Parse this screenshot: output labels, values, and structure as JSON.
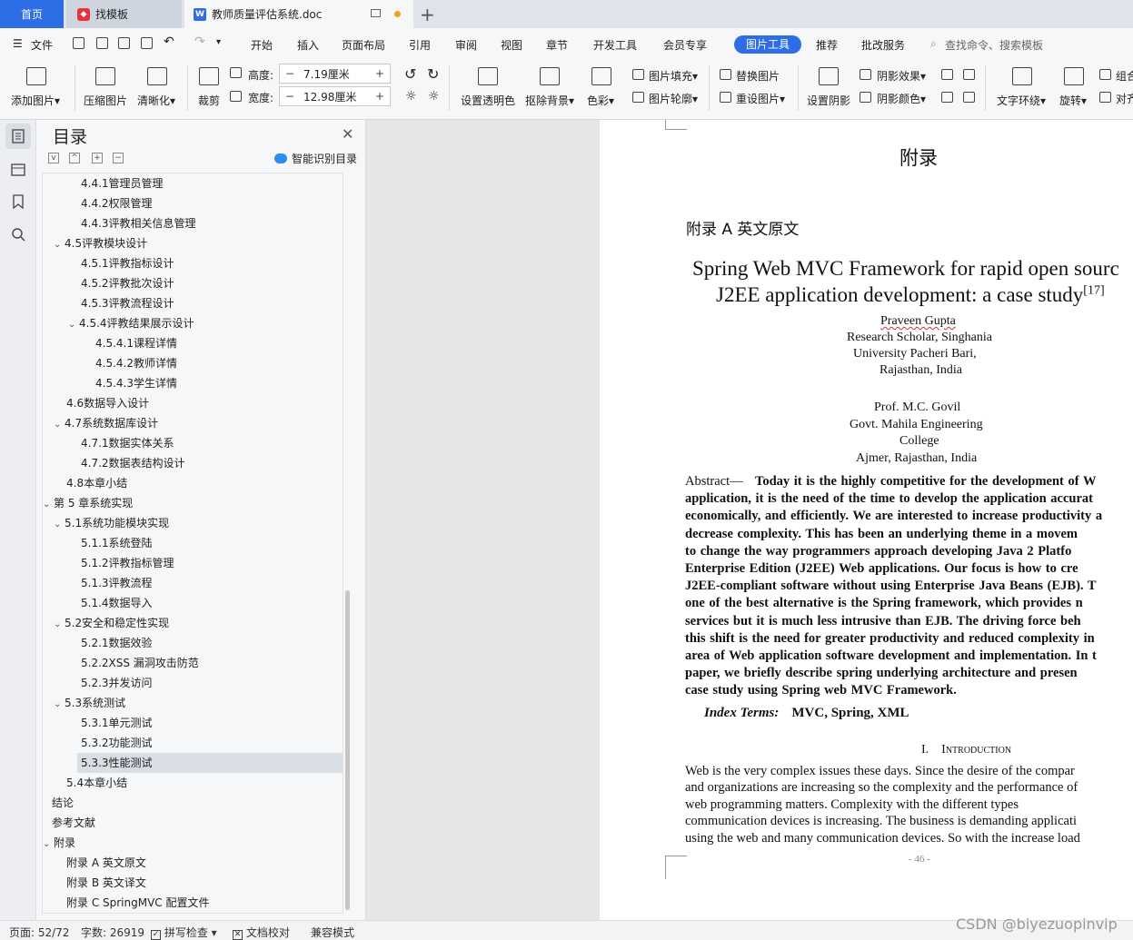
{
  "tabs": {
    "home": "首页",
    "find_template": "找模板",
    "doc": "教师质量评估系统.doc"
  },
  "menu": {
    "file": "文件",
    "items": [
      "开始",
      "插入",
      "页面布局",
      "引用",
      "审阅",
      "视图",
      "章节",
      "开发工具",
      "会员专享"
    ],
    "active": "图片工具",
    "items_after": [
      "推荐",
      "批改服务"
    ],
    "search": "查找命令、搜索模板"
  },
  "ribbon": {
    "add_image": "添加图片",
    "compress": "压缩图片",
    "clarity": "清晰化",
    "crop": "裁剪",
    "height_label": "高度:",
    "height_value": "7.19厘米",
    "width_label": "宽度:",
    "width_value": "12.98厘米",
    "transparent": "设置透明色",
    "remove_bg": "抠除背景",
    "color": "色彩",
    "image_fill": "图片填充",
    "image_outline": "图片轮廓",
    "replace_image": "替换图片",
    "reset_image": "重设图片",
    "set_shadow": "设置阴影",
    "shadow_effect": "阴影效果",
    "shadow_color": "阴影颜色",
    "text_wrap": "文字环绕",
    "rotate": "旋转",
    "group": "组合",
    "align": "对齐"
  },
  "toc": {
    "title": "目录",
    "smart": "智能识别目录",
    "items": [
      {
        "text": "4.4.1管理员管理",
        "level": 3,
        "caret": ""
      },
      {
        "text": "4.4.2权限管理",
        "level": 3,
        "caret": ""
      },
      {
        "text": "4.4.3评教相关信息管理",
        "level": 3,
        "caret": ""
      },
      {
        "text": "4.5评教模块设计",
        "level": 2,
        "caret": "v"
      },
      {
        "text": "4.5.1评教指标设计",
        "level": 3,
        "caret": ""
      },
      {
        "text": "4.5.2评教批次设计",
        "level": 3,
        "caret": ""
      },
      {
        "text": "4.5.3评教流程设计",
        "level": 3,
        "caret": ""
      },
      {
        "text": "4.5.4评教结果展示设计",
        "level": 3,
        "caret": "v"
      },
      {
        "text": "4.5.4.1课程详情",
        "level": 4,
        "caret": ""
      },
      {
        "text": "4.5.4.2教师详情",
        "level": 4,
        "caret": ""
      },
      {
        "text": "4.5.4.3学生详情",
        "level": 4,
        "caret": ""
      },
      {
        "text": "4.6数据导入设计",
        "level": 2,
        "caret": ""
      },
      {
        "text": "4.7系统数据库设计",
        "level": 2,
        "caret": "v"
      },
      {
        "text": "4.7.1数据实体关系",
        "level": 3,
        "caret": ""
      },
      {
        "text": "4.7.2数据表结构设计",
        "level": 3,
        "caret": ""
      },
      {
        "text": "4.8本章小结",
        "level": 2,
        "caret": ""
      },
      {
        "text": "第 5 章系统实现",
        "level": 1,
        "caret": "v"
      },
      {
        "text": "5.1系统功能模块实现",
        "level": 2,
        "caret": "v"
      },
      {
        "text": "5.1.1系统登陆",
        "level": 3,
        "caret": ""
      },
      {
        "text": "5.1.2评教指标管理",
        "level": 3,
        "caret": ""
      },
      {
        "text": "5.1.3评教流程",
        "level": 3,
        "caret": ""
      },
      {
        "text": "5.1.4数据导入",
        "level": 3,
        "caret": ""
      },
      {
        "text": "5.2安全和稳定性实现",
        "level": 2,
        "caret": "v"
      },
      {
        "text": "5.2.1数据效验",
        "level": 3,
        "caret": ""
      },
      {
        "text": "5.2.2XSS 漏洞攻击防范",
        "level": 3,
        "caret": ""
      },
      {
        "text": "5.2.3并发访问",
        "level": 3,
        "caret": ""
      },
      {
        "text": "5.3系统测试",
        "level": 2,
        "caret": "v"
      },
      {
        "text": "5.3.1单元测试",
        "level": 3,
        "caret": ""
      },
      {
        "text": "5.3.2功能测试",
        "level": 3,
        "caret": ""
      },
      {
        "text": "5.3.3性能测试",
        "level": 3,
        "caret": "",
        "selected": true
      },
      {
        "text": "5.4本章小结",
        "level": 2,
        "caret": ""
      },
      {
        "text": "结论",
        "level": 1,
        "caret": ""
      },
      {
        "text": "参考文献",
        "level": 1,
        "caret": ""
      },
      {
        "text": "附录",
        "level": 1,
        "caret": "v"
      },
      {
        "text": "附录 A 英文原文",
        "level": 2,
        "caret": ""
      },
      {
        "text": "附录 B 英文译文",
        "level": 2,
        "caret": ""
      },
      {
        "text": "附录 C SpringMVC 配置文件",
        "level": 2,
        "caret": ""
      }
    ]
  },
  "document": {
    "heading": "附录",
    "subheading": "附录 A  英文原文",
    "paper_title_1": "Spring Web MVC Framework for rapid open sourc",
    "paper_title_2": "J2EE application development: a case study",
    "paper_title_ref": "[17]",
    "author1": [
      "Praveen Gupta",
      "Research Scholar, Singhania",
      "University   Pacheri Bari,",
      "Rajasthan, India"
    ],
    "author2": [
      "Prof. M.C. Govil",
      "Govt. Mahila Engineering",
      "College",
      "Ajmer, Rajasthan, India"
    ],
    "abstract_label": "Abstract—",
    "abstract_lines": [
      "Today it is the highly competitive for the development of W",
      "application, it is the need of the time to develop the application accurat",
      "economically, and efficiently. We are interested to increase productivity a",
      "decrease complexity.    This has been an underlying theme in a movem",
      "to change the way programmers approach developing Java 2 Platfo",
      "Enterprise Edition (J2EE) Web applications.    Our focus is how to cre",
      "J2EE-compliant software without using Enterprise Java Beans (EJB). T",
      "one of the best alternative is the Spring framework, which provides n",
      "services but it is much less intrusive than EJB. The driving force beh",
      "this shift is the need for greater productivity and reduced complexity in",
      "area of Web application software development and implementation. In t",
      "paper, we briefly describe spring underlying architecture and presen",
      "case study using Spring web MVC Framework."
    ],
    "index_label": "Index Terms:",
    "index_terms": "MVC, Spring, XML",
    "section_num": "I.",
    "section_title": "Introduction",
    "intro_lines": [
      "Web is the very complex issues these days. Since the desire of the compar",
      "and organizations are increasing so the complexity and the performance of",
      "web    programming    matters.    Complexity    with    the    different    types",
      "communication devices is increasing. The business is demanding applicati",
      "using the web and many communication devices. So with the increase load"
    ],
    "page_number": "- 46 -"
  },
  "status": {
    "page": "页面: 52/72",
    "words": "字数: 26919",
    "spell": "拼写检查",
    "proof": "文档校对",
    "compat": "兼容模式",
    "watermark": "CSDN @biyezuopinvip"
  },
  "colors": {
    "accent": "#2d6ee6",
    "selection": "#d9dde4",
    "spell_underline": "#d03030"
  }
}
